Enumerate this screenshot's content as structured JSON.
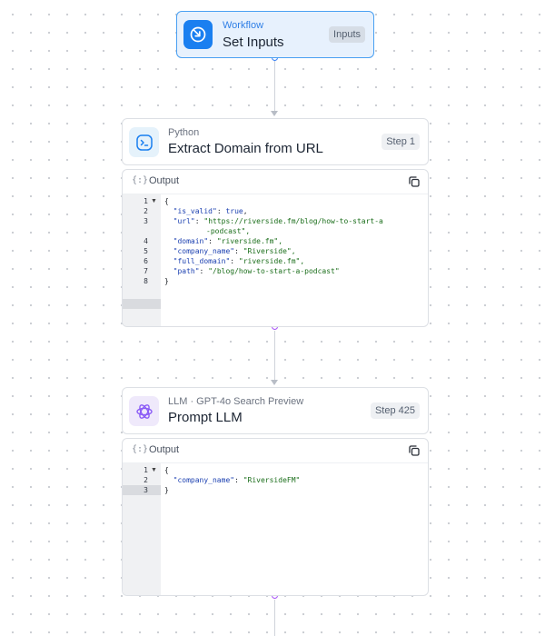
{
  "start_node": {
    "kicker": "Workflow",
    "title": "Set Inputs",
    "badge": "Inputs"
  },
  "python_node": {
    "kicker": "Python",
    "title": "Extract Domain from URL",
    "badge": "Step 1",
    "icon": "terminal-icon"
  },
  "python_output": {
    "label": "Output",
    "line_numbers": [
      "1",
      "2",
      "3",
      "4",
      "5",
      "6",
      "7",
      "8"
    ],
    "open_brace": "{",
    "close_brace": "}",
    "fields": [
      {
        "key": "\"is_valid\"",
        "value": "true"
      },
      {
        "key": "\"url\"",
        "value": "\"https://riverside.fm/blog/how-to-start-a",
        "cont": "-podcast\","
      },
      {
        "key": "\"domain\"",
        "value": "\"riverside.fm\","
      },
      {
        "key": "\"company_name\"",
        "value": "\"Riverside\","
      },
      {
        "key": "\"full_domain\"",
        "value": "\"riverside.fm\","
      },
      {
        "key": "\"path\"",
        "value": "\"/blog/how-to-start-a-podcast\""
      }
    ]
  },
  "llm_node": {
    "kicker": "LLM · GPT-4o Search Preview",
    "title": "Prompt LLM",
    "badge": "Step 425",
    "icon": "openai-icon"
  },
  "llm_output": {
    "label": "Output",
    "line_numbers": [
      "1",
      "2",
      "3"
    ],
    "open_brace": "{",
    "close_brace": "}",
    "fields": [
      {
        "key": "\"company_name\"",
        "value": "\"RiversideFM\""
      }
    ]
  },
  "colors": {
    "accent_blue": "#1a7ff0",
    "llm_purple": "#a855f7"
  }
}
